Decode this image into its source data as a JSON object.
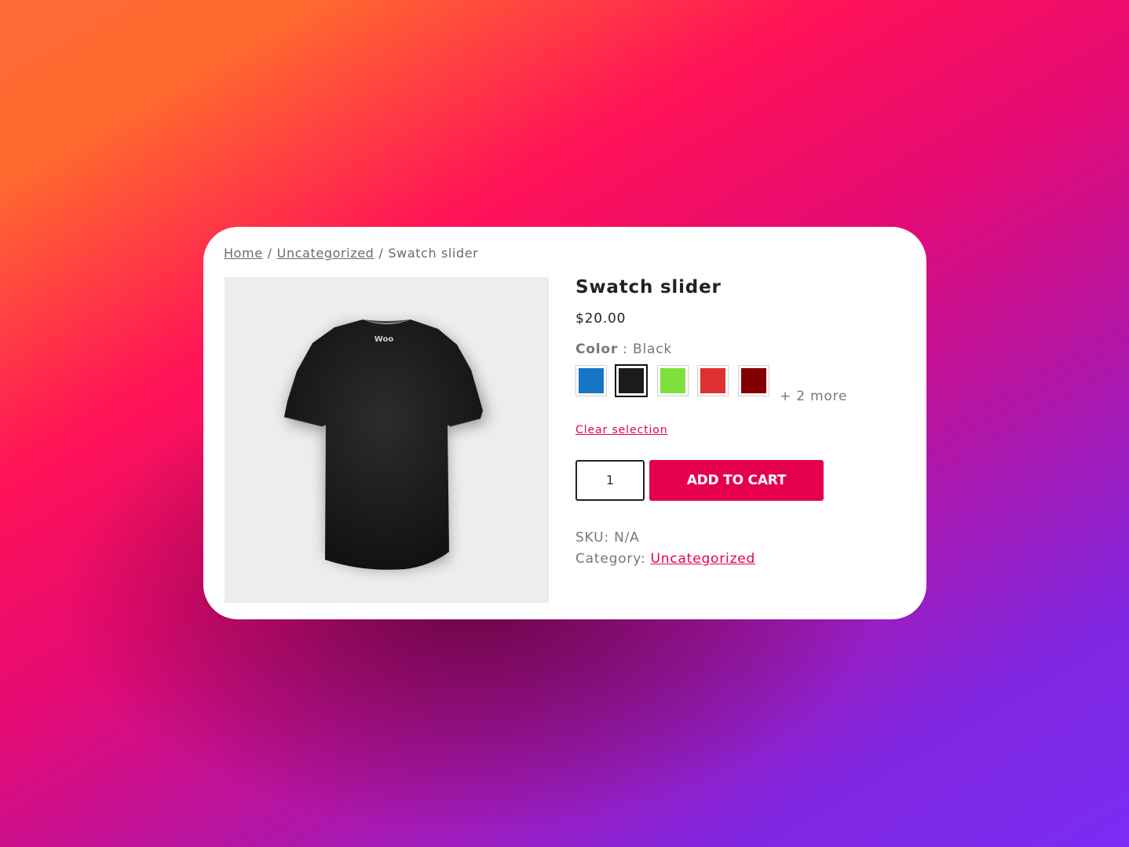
{
  "breadcrumb": {
    "home": "Home",
    "sep1": "/",
    "category": "Uncategorized",
    "sep2": "/",
    "current": "Swatch slider"
  },
  "product": {
    "title": "Swatch slider",
    "price": "$20.00",
    "image_logo_text": "Woo",
    "color_label": "Color",
    "color_sep": " : ",
    "color_value": "Black",
    "swatches": [
      {
        "color": "#1874c5",
        "selected": false
      },
      {
        "color": "#1c1c1c",
        "selected": true
      },
      {
        "color": "#80e03b",
        "selected": false
      },
      {
        "color": "#dd3030",
        "selected": false
      },
      {
        "color": "#830000",
        "selected": false
      }
    ],
    "more_label": "+ 2 more",
    "clear_label": "Clear selection",
    "quantity": "1",
    "add_to_cart": "ADD TO CART",
    "sku_label": "SKU: ",
    "sku_value": "N/A",
    "category_label": "Category: ",
    "category_value": "Uncategorized"
  },
  "colors": {
    "accent": "#e5004f",
    "card_bg": "#ffffff",
    "image_bg": "#ededed"
  }
}
